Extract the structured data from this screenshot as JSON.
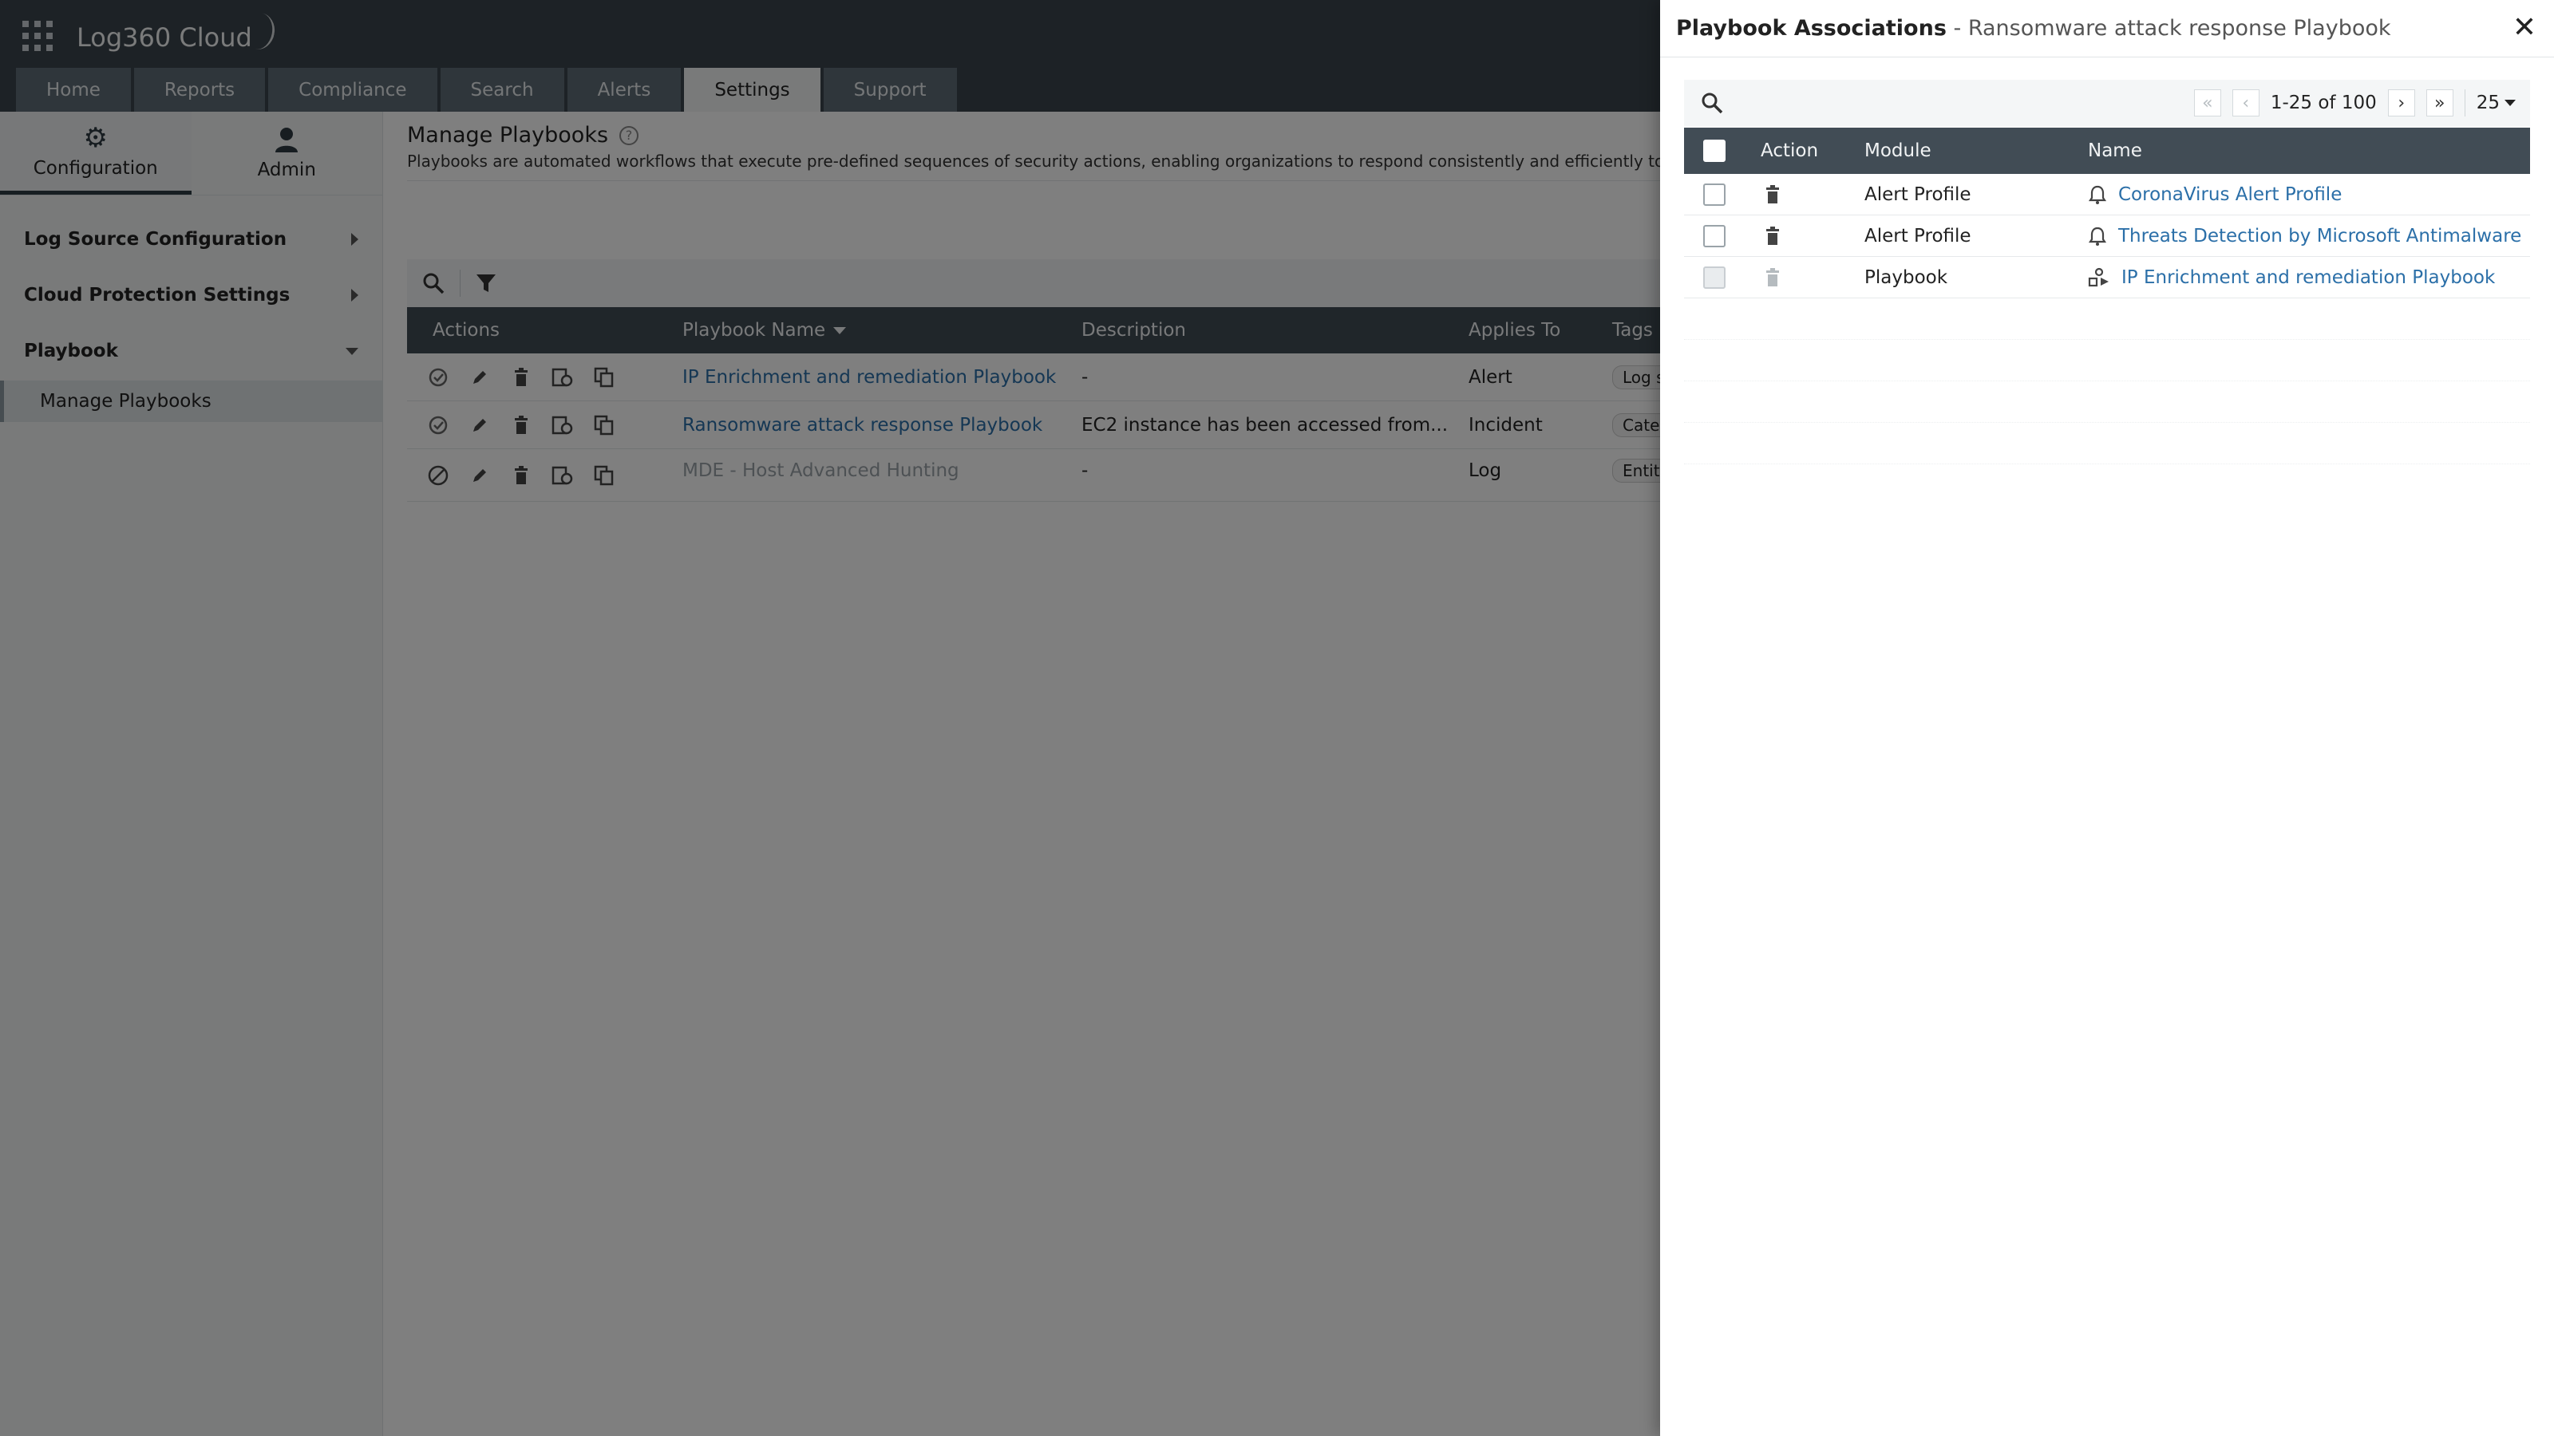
{
  "app": {
    "title": "Log360 Cloud",
    "tabs": [
      "Home",
      "Reports",
      "Compliance",
      "Search",
      "Alerts",
      "Settings",
      "Support"
    ],
    "active_tab": "Settings"
  },
  "sidebar": {
    "switch": [
      {
        "label": "Configuration",
        "icon": "gear-icon"
      },
      {
        "label": "Admin",
        "icon": "user-icon"
      }
    ],
    "groups": [
      {
        "label": "Log Source Configuration"
      },
      {
        "label": "Cloud Protection Settings"
      },
      {
        "label": "Playbook"
      }
    ],
    "active_item": "Manage Playbooks"
  },
  "main": {
    "title": "Manage Playbooks",
    "description": "Playbooks are automated workflows that execute pre-defined sequences of security actions, enabling organizations to respond consistently and efficiently to",
    "columns": [
      "Actions",
      "Playbook Name",
      "Description",
      "Applies To",
      "Tags"
    ],
    "rows": [
      {
        "name": "IP Enrichment and remediation Playbook",
        "description": "-",
        "applies_to": "Alert",
        "tag": "Log s",
        "enabled": true
      },
      {
        "name": "Ransomware attack response Playbook",
        "description": "EC2 instance has been accessed from...",
        "applies_to": "Incident",
        "tag": "Cate",
        "enabled": true
      },
      {
        "name": "MDE - Host Advanced Hunting",
        "description": "-",
        "applies_to": "Log",
        "tag": "Entit",
        "enabled": false
      }
    ]
  },
  "panel": {
    "title": "Playbook Associations",
    "subtitle": "Ransomware attack response Playbook",
    "pagination": {
      "range": "1-25 of 100",
      "per_page": "25"
    },
    "columns": [
      "Action",
      "Module",
      "Name"
    ],
    "rows": [
      {
        "module": "Alert Profile",
        "name": "CoronaVirus Alert Profile",
        "icon": "bell-icon"
      },
      {
        "module": "Alert Profile",
        "name": "Threats Detection by Microsoft Antimalware",
        "icon": "bell-icon"
      },
      {
        "module": "Playbook",
        "name": "IP Enrichment and remediation Playbook",
        "icon": "playbook-icon"
      }
    ]
  }
}
